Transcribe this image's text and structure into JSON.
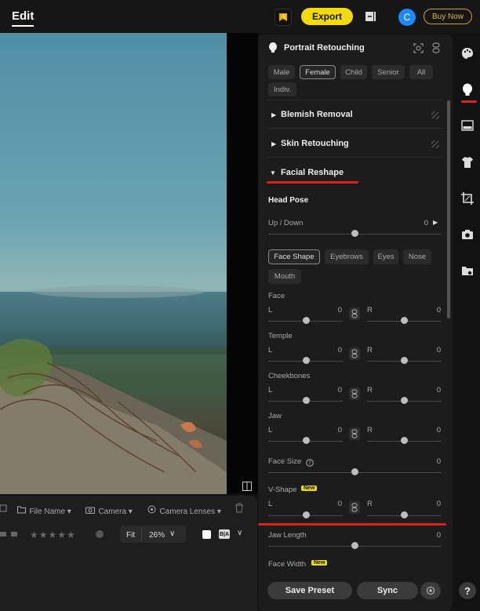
{
  "header": {
    "title": "Edit",
    "export_label": "Export",
    "avatar_letter": "C",
    "buy_label": "Buy Now"
  },
  "filmstrip": {
    "file_name": "File Name",
    "camera": "Camera",
    "camera_lenses": "Camera Lenses",
    "fit_label": "Fit",
    "zoom": "26%",
    "compare_label": "B|A"
  },
  "panel": {
    "title": "Portrait Retouching",
    "gender_tabs": [
      "Male",
      "Female",
      "Child",
      "Senior",
      "All",
      "Indiv."
    ],
    "gender_selected": "Female",
    "sections": {
      "blemish": "Blemish Removal",
      "skin": "Skin Retouching",
      "facial": "Facial Reshape"
    },
    "head_pose": {
      "title": "Head Pose",
      "updown_label": "Up / Down",
      "updown_value": "0"
    },
    "shape_tabs": [
      "Face Shape",
      "Eyebrows",
      "Eyes",
      "Nose",
      "Mouth"
    ],
    "shape_selected": "Face Shape",
    "lr_sliders": [
      {
        "name": "Face",
        "l": "0",
        "r": "0"
      },
      {
        "name": "Temple",
        "l": "0",
        "r": "0"
      },
      {
        "name": "Cheekbones",
        "l": "0",
        "r": "0"
      },
      {
        "name": "Jaw",
        "l": "0",
        "r": "0"
      }
    ],
    "face_size": {
      "label": "Face Size",
      "value": "0"
    },
    "v_shape": {
      "label": "V-Shape",
      "badge": "New",
      "l": "0",
      "r": "0"
    },
    "jaw_length": {
      "label": "Jaw Length",
      "value": "0"
    },
    "face_width": {
      "label": "Face Width",
      "badge": "New"
    },
    "l_label": "L",
    "r_label": "R",
    "save_preset": "Save Preset",
    "sync": "Sync"
  },
  "help_label": "?",
  "colors": {
    "accent": "#f3da0b",
    "highlight": "#d9231f",
    "avatar": "#1e88ff"
  }
}
